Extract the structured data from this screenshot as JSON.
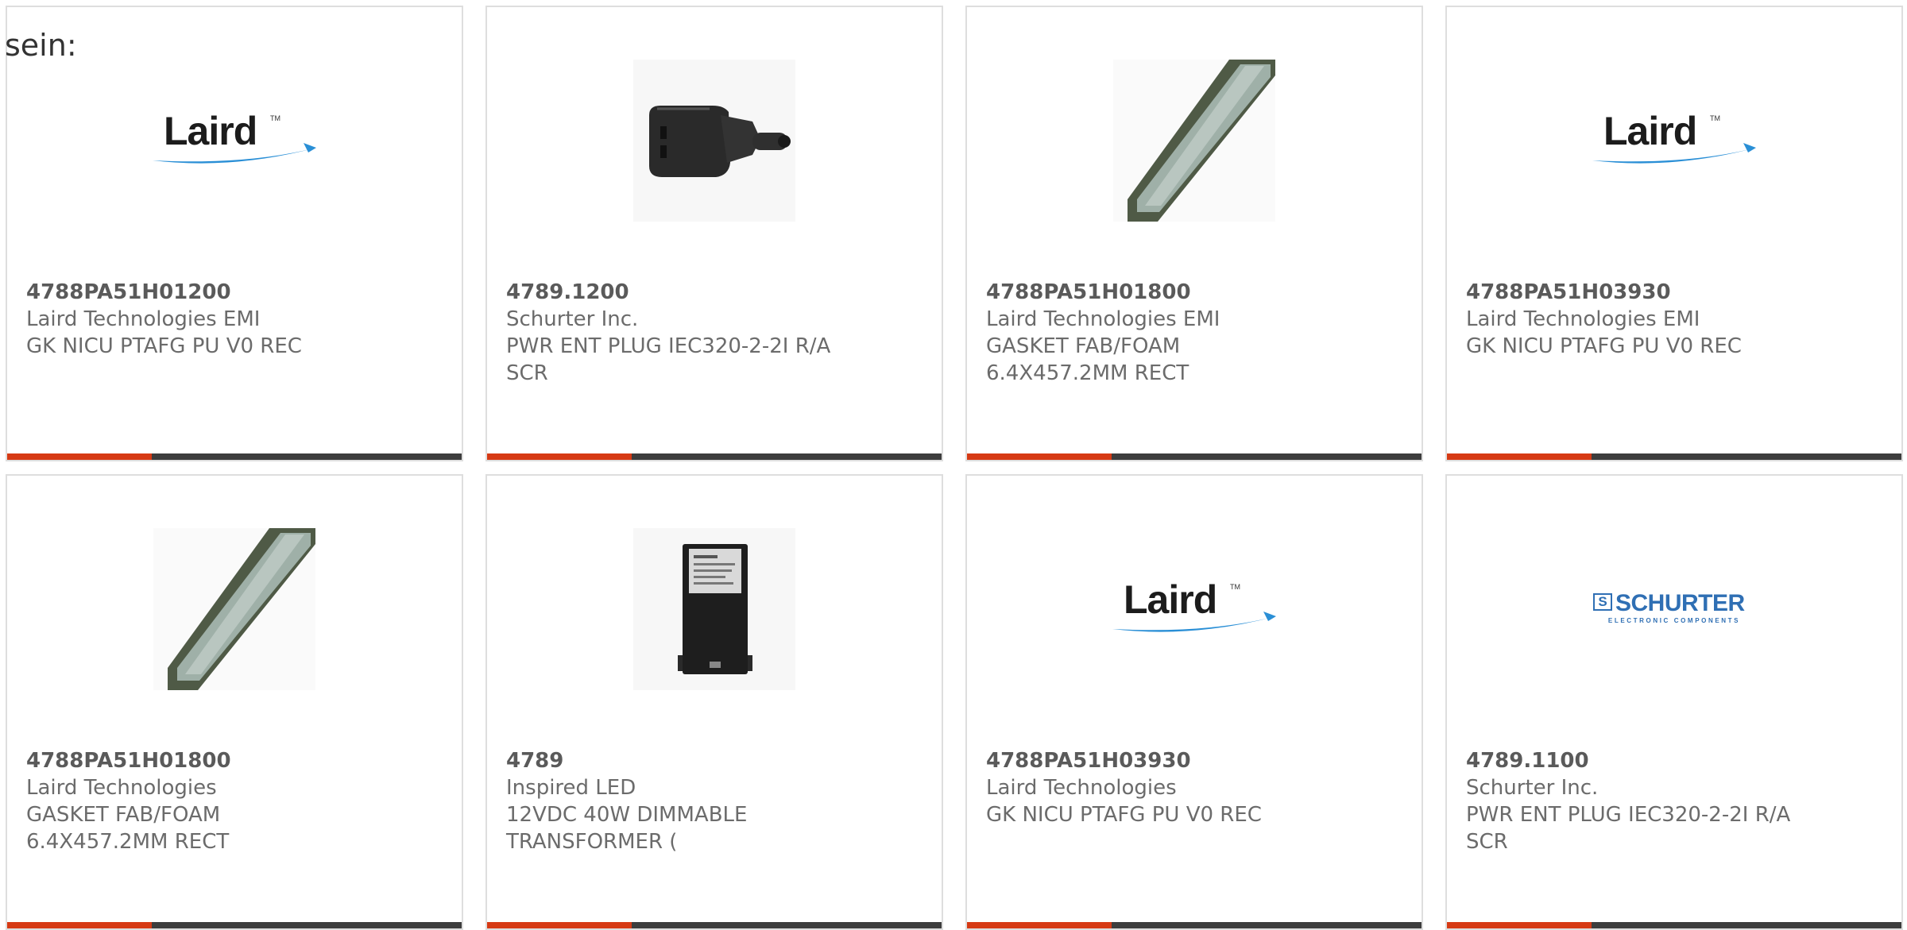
{
  "intro_text": "sein:",
  "colors": {
    "accent": "#d63a14",
    "bar": "#3d3d3d",
    "border": "#dedede",
    "text": "#6b6b6b",
    "schurter_blue": "#2f6fb4",
    "laird_swoosh": "#2a8fd6"
  },
  "products": [
    {
      "part_number": "4788PA51H01200",
      "manufacturer": "Laird Technologies EMI",
      "description": "GK NICU PTAFG PU V0 REC",
      "image": "laird-logo",
      "logo_text": "Laird"
    },
    {
      "part_number": "4789.1200",
      "manufacturer": "Schurter Inc.",
      "description": "PWR ENT PLUG IEC320-2-2I R/A SCR",
      "image": "power-plug-photo"
    },
    {
      "part_number": "4788PA51H01800",
      "manufacturer": "Laird Technologies EMI",
      "description": "GASKET FAB/FOAM 6.4X457.2MM RECT",
      "image": "gasket-strip-photo"
    },
    {
      "part_number": "4788PA51H03930",
      "manufacturer": "Laird Technologies EMI",
      "description": "GK NICU PTAFG PU V0 REC",
      "image": "laird-logo",
      "logo_text": "Laird"
    },
    {
      "part_number": "4788PA51H01800",
      "manufacturer": "Laird Technologies",
      "description": "GASKET FAB/FOAM 6.4X457.2MM RECT",
      "image": "gasket-strip-photo"
    },
    {
      "part_number": "4789",
      "manufacturer": "Inspired LED",
      "description": "12VDC 40W DIMMABLE TRANSFORMER (",
      "image": "transformer-photo"
    },
    {
      "part_number": "4788PA51H03930",
      "manufacturer": "Laird Technologies",
      "description": "GK NICU PTAFG PU V0 REC",
      "image": "laird-logo",
      "logo_text": "Laird"
    },
    {
      "part_number": "4789.1100",
      "manufacturer": "Schurter Inc.",
      "description": "PWR ENT PLUG IEC320-2-2I R/A SCR",
      "image": "schurter-logo",
      "logo_text": "SCHURTER",
      "logo_box": "S",
      "logo_subtext": "ELECTRONIC COMPONENTS"
    }
  ]
}
